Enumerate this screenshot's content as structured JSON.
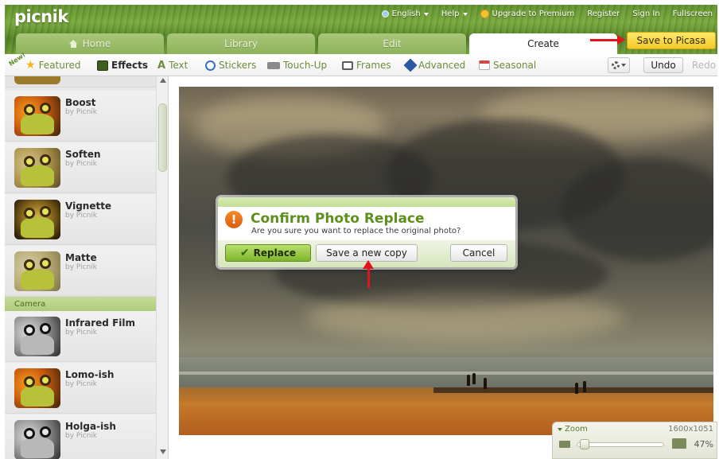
{
  "app": {
    "logo": "picnik"
  },
  "topnav": {
    "language": "English",
    "help": "Help",
    "upgrade": "Upgrade to Premium",
    "register": "Register",
    "sign_in": "Sign In",
    "fullscreen": "Fullscreen"
  },
  "tabs": [
    {
      "label": "Home"
    },
    {
      "label": "Library"
    },
    {
      "label": "Edit"
    },
    {
      "label": "Create"
    }
  ],
  "active_tab": "Create",
  "save_button": "Save to Picasa",
  "toolbar": {
    "new_badge": "New!",
    "featured": "Featured",
    "effects": "Effects",
    "text": "Text",
    "stickers": "Stickers",
    "touch_up": "Touch-Up",
    "frames": "Frames",
    "advanced": "Advanced",
    "seasonal": "Seasonal",
    "undo": "Undo",
    "redo": "Redo"
  },
  "sidebar": {
    "effects": [
      {
        "name": "Boost",
        "by": "by Picnik"
      },
      {
        "name": "Soften",
        "by": "by Picnik"
      },
      {
        "name": "Vignette",
        "by": "by Picnik"
      },
      {
        "name": "Matte",
        "by": "by Picnik"
      }
    ],
    "section": "Camera",
    "camera_effects": [
      {
        "name": "Infrared Film",
        "by": "by Picnik"
      },
      {
        "name": "Lomo-ish",
        "by": "by Picnik"
      },
      {
        "name": "Holga-ish",
        "by": "by Picnik"
      }
    ]
  },
  "dialog": {
    "title": "Confirm Photo Replace",
    "message": "Are you sure you want to replace the original photo?",
    "replace": "Replace",
    "save_copy": "Save a new copy",
    "cancel": "Cancel"
  },
  "zoom": {
    "label": "Zoom",
    "dimensions": "1600x1051",
    "percent": "47%"
  },
  "colors": {
    "annotation_arrow": "#e2141c",
    "accent_green": "#5e8f1d",
    "save_button": "#f3c928"
  }
}
